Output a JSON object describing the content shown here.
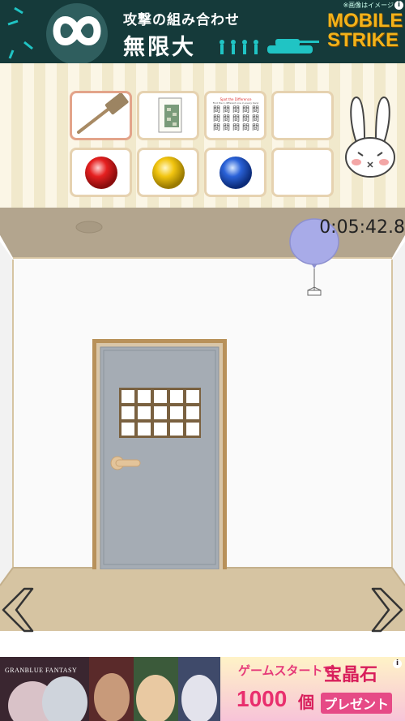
{
  "top_ad": {
    "note": "※画像はイメージ",
    "info": "i",
    "headline": "攻撃の組み合わせ",
    "big_text": "無限大",
    "brand_line1": "MOBILE",
    "brand_line2": "STRIKE"
  },
  "inventory": {
    "slots": [
      {
        "item": "hammer",
        "selected": true
      },
      {
        "item": "panel-card",
        "selected": false
      },
      {
        "item": "spot-difference-note",
        "selected": false
      },
      {
        "item": "empty",
        "selected": false
      },
      {
        "item": "red-ball",
        "selected": false
      },
      {
        "item": "yellow-ball",
        "selected": false
      },
      {
        "item": "blue-ball",
        "selected": false
      },
      {
        "item": "empty",
        "selected": false
      }
    ],
    "note_title": "Spot the Difference",
    "note_subtitle": "Find the 1 different one in every Kanji",
    "note_char": "問",
    "mascot": "rabbit-mascot-icon"
  },
  "timer": "0:05:42.8",
  "colors": {
    "wall": "#fafafa",
    "ceiling": "#b3a58e",
    "floor": "#d6c4a2",
    "door": "#a5acb4",
    "door_frame": "#b8915a",
    "balloon": "#a8abe8"
  },
  "bottom_ad": {
    "game_title": "GRANBLUE FANTASY",
    "promo_line1": "ゲームスタートで",
    "promo_line1b": "宝晶石",
    "promo_line2": "1000",
    "promo_line2b": "個",
    "promo_line3": "プレゼント",
    "info": "i"
  }
}
